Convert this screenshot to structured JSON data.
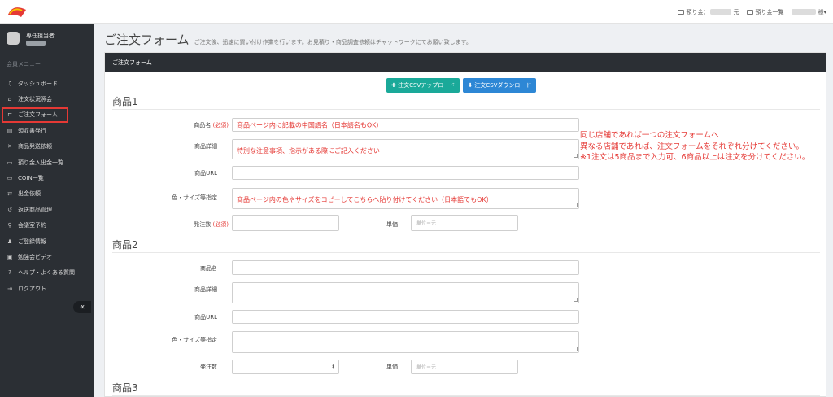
{
  "header": {
    "balance_label": "預り金：",
    "balance_unit": "元",
    "deposit_list": "預り金一覧",
    "user_suffix": "様▾"
  },
  "sidebar": {
    "profile_name": "専任担当者",
    "heading": "会員メニュー",
    "items": [
      {
        "icon": "♫",
        "icon_name": "bell-icon",
        "label": "ダッシュボード"
      },
      {
        "icon": "⌂",
        "icon_name": "bank-icon",
        "label": "注文状況照会"
      },
      {
        "icon": "⊏",
        "icon_name": "cart-icon",
        "label": "ご注文フォーム"
      },
      {
        "icon": "▤",
        "icon_name": "document-icon",
        "label": "領収書発行"
      },
      {
        "icon": "✕",
        "icon_name": "tools-icon",
        "label": "商品発送依頼"
      },
      {
        "icon": "▭",
        "icon_name": "money-icon",
        "label": "預り金入出金一覧"
      },
      {
        "icon": "▭",
        "icon_name": "coin-icon",
        "label": "COIN一覧"
      },
      {
        "icon": "⇄",
        "icon_name": "transfer-icon",
        "label": "出金依頼"
      },
      {
        "icon": "↺",
        "icon_name": "return-icon",
        "label": "返送商品管理"
      },
      {
        "icon": "⚲",
        "icon_name": "key-icon",
        "label": "会議室予約"
      },
      {
        "icon": "♟",
        "icon_name": "user-icon",
        "label": "ご登録情報"
      },
      {
        "icon": "▣",
        "icon_name": "film-icon",
        "label": "勉強会ビデオ"
      },
      {
        "icon": "?",
        "icon_name": "help-icon",
        "label": "ヘルプ・よくある質問"
      },
      {
        "icon": "⇥",
        "icon_name": "logout-icon",
        "label": "ログアウト"
      }
    ],
    "collapse": "«"
  },
  "page": {
    "title": "ご注文フォーム",
    "subtitle": "ご注文後、迅速に買い付け作業を行います。お見積り・商品調査依頼はチャットワークにてお願い致します。"
  },
  "panel": {
    "heading": "ご注文フォーム",
    "upload_button": "✚ 注文CSVアップロード",
    "download_button": "⬇ 注文CSVダウンロード"
  },
  "products": [
    {
      "title": "商品1",
      "name_label": "商品名",
      "required": "(必須)",
      "name_placeholder": "商品ページ内に記載の中国語名（日本語名もOK）",
      "detail_label": "商品詳細",
      "detail_placeholder": "特別な注意事項、指示がある際にご記入ください",
      "url_label": "商品URL",
      "color_label": "色・サイズ等指定",
      "color_placeholder": "商品ページ内の色やサイズをコピーしてこちらへ貼り付けてください（日本語でもOK）",
      "qty_label": "発注数",
      "price_label": "単価",
      "price_placeholder": "単位＝元"
    },
    {
      "title": "商品2",
      "name_label": "商品名",
      "detail_label": "商品詳細",
      "url_label": "商品URL",
      "color_label": "色・サイズ等指定",
      "qty_label": "発注数",
      "price_label": "単価",
      "price_placeholder": "単位＝元"
    },
    {
      "title": "商品3"
    }
  ],
  "note": {
    "line1": "同じ店舗であれば一つの注文フォームへ",
    "line2": "異なる店舗であれば、注文フォームをそれぞれ分けてください。",
    "line3": "※1注文は5商品まで入力可、6商品以上は注文を分けてください。"
  },
  "colors": {
    "accent_red": "#e53935",
    "teal": "#1aa999",
    "blue": "#2d87d5",
    "sidebar": "#2b2f34"
  }
}
